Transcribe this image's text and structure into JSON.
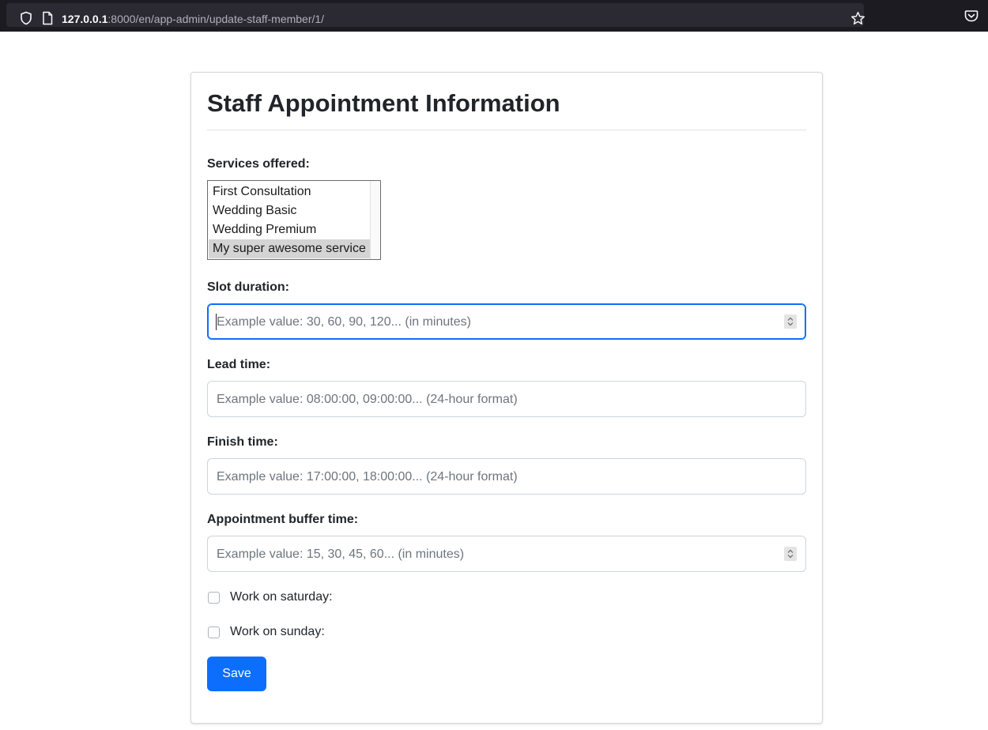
{
  "browser": {
    "url_host": "127.0.0.1",
    "url_rest": ":8000/en/app-admin/update-staff-member/1/",
    "icons": [
      "shield-icon",
      "page-icon",
      "star-icon",
      "pocket-icon"
    ]
  },
  "form": {
    "title": "Staff Appointment Information",
    "services": {
      "label": "Services offered:",
      "options": [
        {
          "label": "First Consultation",
          "selected": false
        },
        {
          "label": "Wedding Basic",
          "selected": false
        },
        {
          "label": "Wedding Premium",
          "selected": false
        },
        {
          "label": "My super awesome service",
          "selected": true
        }
      ]
    },
    "slot_duration": {
      "label": "Slot duration:",
      "value": "",
      "placeholder": "Example value: 30, 60, 90, 120... (in minutes)"
    },
    "lead_time": {
      "label": "Lead time:",
      "value": "",
      "placeholder": "Example value: 08:00:00, 09:00:00... (24-hour format)"
    },
    "finish_time": {
      "label": "Finish time:",
      "value": "",
      "placeholder": "Example value: 17:00:00, 18:00:00... (24-hour format)"
    },
    "buffer_time": {
      "label": "Appointment buffer time:",
      "value": "",
      "placeholder": "Example value: 15, 30, 45, 60... (in minutes)"
    },
    "work_saturday": {
      "label": "Work on saturday:",
      "checked": false
    },
    "work_sunday": {
      "label": "Work on sunday:",
      "checked": false
    },
    "save_label": "Save"
  },
  "colors": {
    "primary": "#0d6efd",
    "browser_bar": "#1c1b22",
    "url_field": "#2b2a33",
    "selected_option": "#d4d4d4"
  }
}
